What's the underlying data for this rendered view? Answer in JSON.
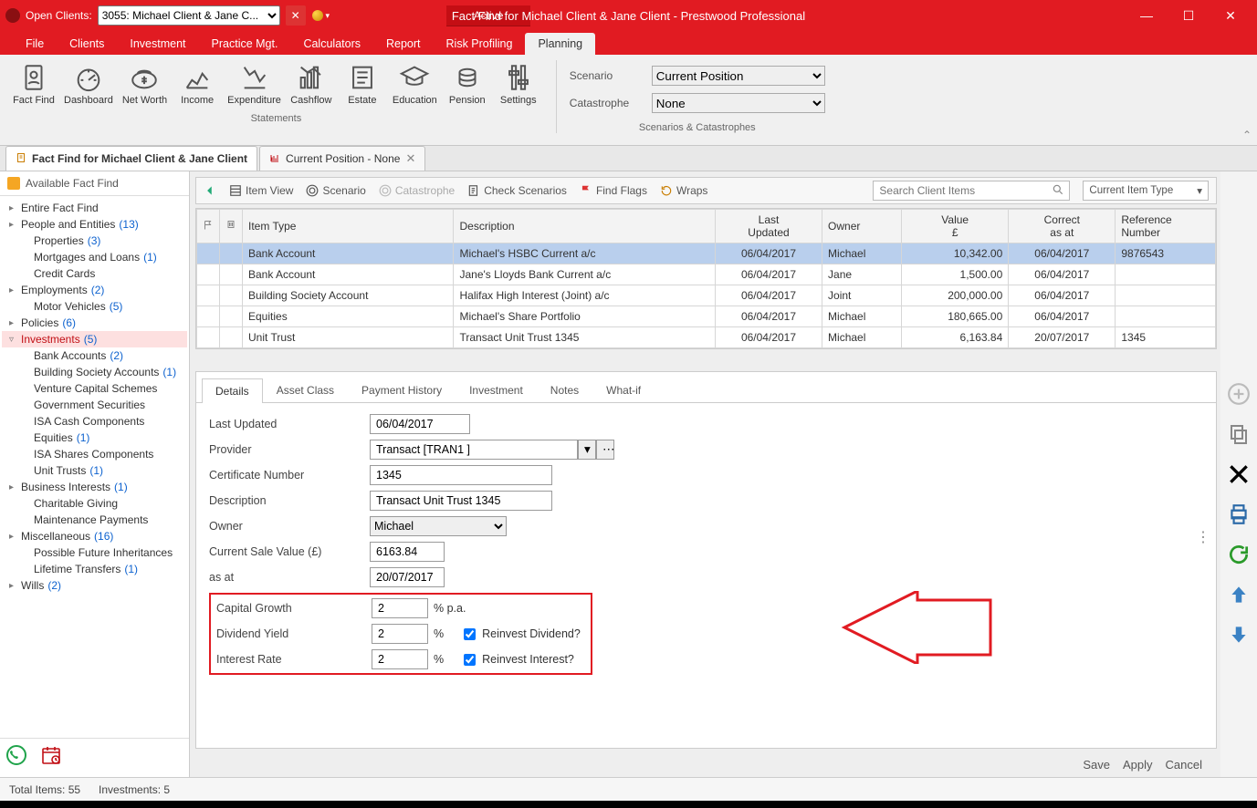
{
  "titlebar": {
    "open_clients_label": "Open Clients:",
    "client_selected": "3055: Michael Client & Jane C...",
    "active_label": "Active",
    "window_title": "Fact Find for Michael Client & Jane Client - Prestwood Professional"
  },
  "menu": {
    "items": [
      "File",
      "Clients",
      "Investment",
      "Practice Mgt.",
      "Calculators",
      "Report",
      "Risk Profiling",
      "Planning"
    ],
    "active_index": 7
  },
  "ribbon": {
    "statements_buttons": [
      {
        "label": "Fact Find",
        "icon": "factfind"
      },
      {
        "label": "Dashboard",
        "icon": "dashboard"
      },
      {
        "label": "Net Worth",
        "icon": "networth"
      },
      {
        "label": "Income",
        "icon": "income"
      },
      {
        "label": "Expenditure",
        "icon": "expenditure"
      },
      {
        "label": "Cashflow",
        "icon": "cashflow"
      },
      {
        "label": "Estate",
        "icon": "estate"
      },
      {
        "label": "Education",
        "icon": "education"
      },
      {
        "label": "Pension",
        "icon": "pension"
      },
      {
        "label": "Settings",
        "icon": "settings"
      }
    ],
    "group1_title": "Statements",
    "scenario_label": "Scenario",
    "scenario_value": "Current Position",
    "catastrophe_label": "Catastrophe",
    "catastrophe_value": "None",
    "group2_title": "Scenarios & Catastrophes"
  },
  "doc_tabs": [
    {
      "label": "Fact Find for Michael Client & Jane Client",
      "active": true
    },
    {
      "label": "Current Position - None",
      "active": false
    }
  ],
  "sidebar": {
    "header": "Available Fact Find",
    "tree": [
      {
        "level": 1,
        "label": "Entire Fact Find",
        "count": "",
        "caret": "▸"
      },
      {
        "level": 1,
        "label": "People and Entities",
        "count": "(13)",
        "caret": "▸"
      },
      {
        "level": 2,
        "label": "Properties",
        "count": "(3)"
      },
      {
        "level": 2,
        "label": "Mortgages and Loans",
        "count": "(1)"
      },
      {
        "level": 2,
        "label": "Credit Cards",
        "count": ""
      },
      {
        "level": 1,
        "label": "Employments",
        "count": "(2)",
        "caret": "▸"
      },
      {
        "level": 2,
        "label": "Motor Vehicles",
        "count": "(5)"
      },
      {
        "level": 1,
        "label": "Policies",
        "count": "(6)",
        "caret": "▸"
      },
      {
        "level": 1,
        "label": "Investments",
        "count": "(5)",
        "caret": "▿",
        "selected": true
      },
      {
        "level": 2,
        "label": "Bank Accounts",
        "count": "(2)"
      },
      {
        "level": 2,
        "label": "Building Society Accounts",
        "count": "(1)"
      },
      {
        "level": 2,
        "label": "Venture Capital Schemes",
        "count": ""
      },
      {
        "level": 2,
        "label": "Government Securities",
        "count": ""
      },
      {
        "level": 2,
        "label": "ISA Cash Components",
        "count": ""
      },
      {
        "level": 2,
        "label": "Equities",
        "count": "(1)"
      },
      {
        "level": 2,
        "label": "ISA Shares Components",
        "count": ""
      },
      {
        "level": 2,
        "label": "Unit Trusts",
        "count": "(1)"
      },
      {
        "level": 1,
        "label": "Business Interests",
        "count": "(1)",
        "caret": "▸"
      },
      {
        "level": 2,
        "label": "Charitable Giving",
        "count": ""
      },
      {
        "level": 2,
        "label": "Maintenance Payments",
        "count": ""
      },
      {
        "level": 1,
        "label": "Miscellaneous",
        "count": "(16)",
        "caret": "▸"
      },
      {
        "level": 2,
        "label": "Possible Future Inheritances",
        "count": ""
      },
      {
        "level": 2,
        "label": "Lifetime Transfers",
        "count": "(1)"
      },
      {
        "level": 1,
        "label": "Wills",
        "count": "(2)",
        "caret": "▸"
      }
    ]
  },
  "toolbar": {
    "back_hint": "Back",
    "item_view": "Item View",
    "scenario": "Scenario",
    "catastrophe": "Catastrophe",
    "check_scenarios": "Check Scenarios",
    "find_flags": "Find Flags",
    "wraps": "Wraps",
    "search_placeholder": "Search Client Items",
    "filter_label": "Current Item Type"
  },
  "grid": {
    "headers": {
      "item_type": "Item Type",
      "description": "Description",
      "last_updated": "Last\nUpdated",
      "owner": "Owner",
      "value": "Value\n£",
      "correct_as_at": "Correct\nas at",
      "reference": "Reference\nNumber"
    },
    "rows": [
      {
        "item_type": "Bank Account",
        "description": "Michael's HSBC Current a/c",
        "last_updated": "06/04/2017",
        "owner": "Michael",
        "value": "10,342.00",
        "correct_as_at": "06/04/2017",
        "reference": "9876543",
        "selected": true
      },
      {
        "item_type": "Bank Account",
        "description": "Jane's Lloyds Bank Current a/c",
        "last_updated": "06/04/2017",
        "owner": "Jane",
        "value": "1,500.00",
        "correct_as_at": "06/04/2017",
        "reference": ""
      },
      {
        "item_type": "Building Society Account",
        "description": "Halifax High Interest (Joint) a/c",
        "last_updated": "06/04/2017",
        "owner": "Joint",
        "value": "200,000.00",
        "correct_as_at": "06/04/2017",
        "reference": ""
      },
      {
        "item_type": "Equities",
        "description": "Michael's Share Portfolio",
        "last_updated": "06/04/2017",
        "owner": "Michael",
        "value": "180,665.00",
        "correct_as_at": "06/04/2017",
        "reference": ""
      },
      {
        "item_type": "Unit Trust",
        "description": "Transact Unit Trust 1345",
        "last_updated": "06/04/2017",
        "owner": "Michael",
        "value": "6,163.84",
        "correct_as_at": "20/07/2017",
        "reference": "1345"
      }
    ]
  },
  "detail_tabs": [
    "Details",
    "Asset Class",
    "Payment History",
    "Investment",
    "Notes",
    "What-if"
  ],
  "form": {
    "last_updated_label": "Last Updated",
    "last_updated": "06/04/2017",
    "provider_label": "Provider",
    "provider": "Transact [TRAN1 ]",
    "certificate_label": "Certificate Number",
    "certificate": "1345",
    "description_label": "Description",
    "description": "Transact Unit Trust 1345",
    "owner_label": "Owner",
    "owner": "Michael",
    "current_value_label": "Current Sale Value (£)",
    "current_value": "6163.84",
    "as_at_label": "as at",
    "as_at": "20/07/2017",
    "capital_growth_label": "Capital Growth",
    "capital_growth": "2",
    "capital_growth_suffix": "%  p.a.",
    "dividend_yield_label": "Dividend Yield",
    "dividend_yield": "2",
    "dividend_yield_suffix": "%",
    "reinvest_dividend_label": "Reinvest Dividend?",
    "interest_rate_label": "Interest Rate",
    "interest_rate": "2",
    "interest_rate_suffix": "%",
    "reinvest_interest_label": "Reinvest Interest?"
  },
  "actions": {
    "save": "Save",
    "apply": "Apply",
    "cancel": "Cancel"
  },
  "statusbar": {
    "total_items": "Total Items: 55",
    "investments": "Investments: 5"
  }
}
